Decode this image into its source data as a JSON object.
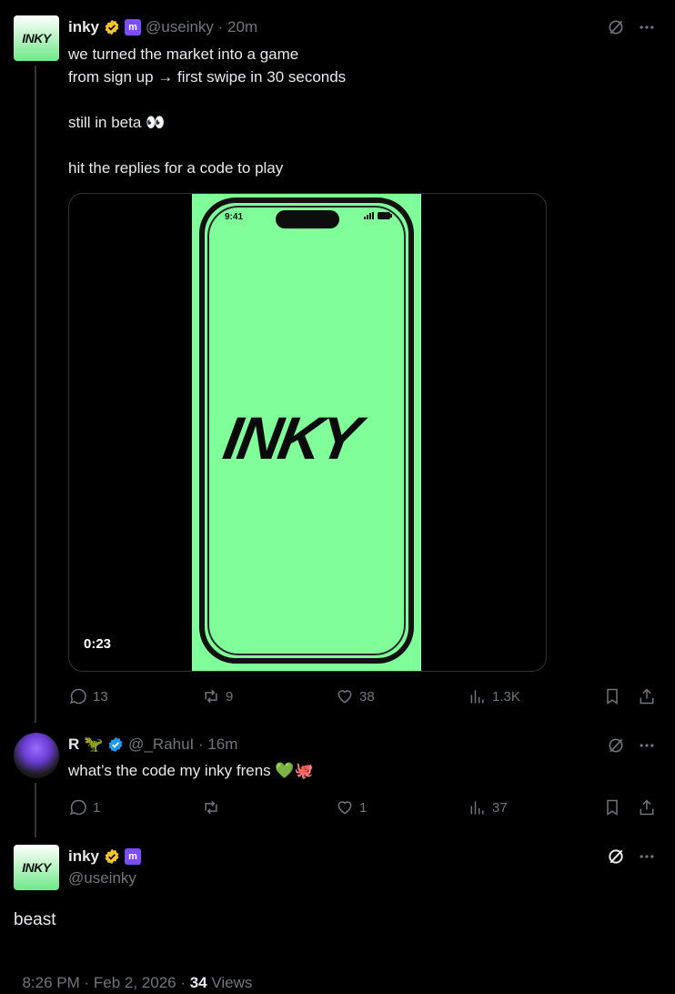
{
  "tweet1": {
    "avatar_text": "INKY",
    "name": "inky",
    "handle_time": "@useinky · 20m",
    "body": "we turned the market into a game\nfrom sign up → first swipe in 30 seconds\n\nstill in beta 👀\n\nhit the replies for a code to play",
    "media": {
      "phone_time": "9:41",
      "logo_text": "INKY",
      "duration": "0:23"
    },
    "stats": {
      "replies": "13",
      "reposts": "9",
      "likes": "38",
      "views": "1.3K"
    }
  },
  "tweet2": {
    "name": "R 🦖",
    "handle_time": "@_RahuI · 16m",
    "body": "what’s the code my inky frens 💚🐙",
    "stats": {
      "replies": "1",
      "reposts": "",
      "likes": "1",
      "views": "37"
    }
  },
  "tweet3": {
    "avatar_text": "INKY",
    "name": "inky",
    "handle": "@useinky",
    "body": "beast",
    "timestamp": "8:26 PM · Feb 2, 2026 · ",
    "views_count": "34",
    "views_label": " Views"
  },
  "colors": {
    "accent_green": "#80fe9a",
    "verified_gold": "#f4c430",
    "verified_blue": "#1d9bf0",
    "muted": "#71767b"
  },
  "icons": [
    "grok-icon",
    "more-icon",
    "reply-icon",
    "repost-icon",
    "like-icon",
    "views-icon",
    "bookmark-icon",
    "share-icon"
  ]
}
